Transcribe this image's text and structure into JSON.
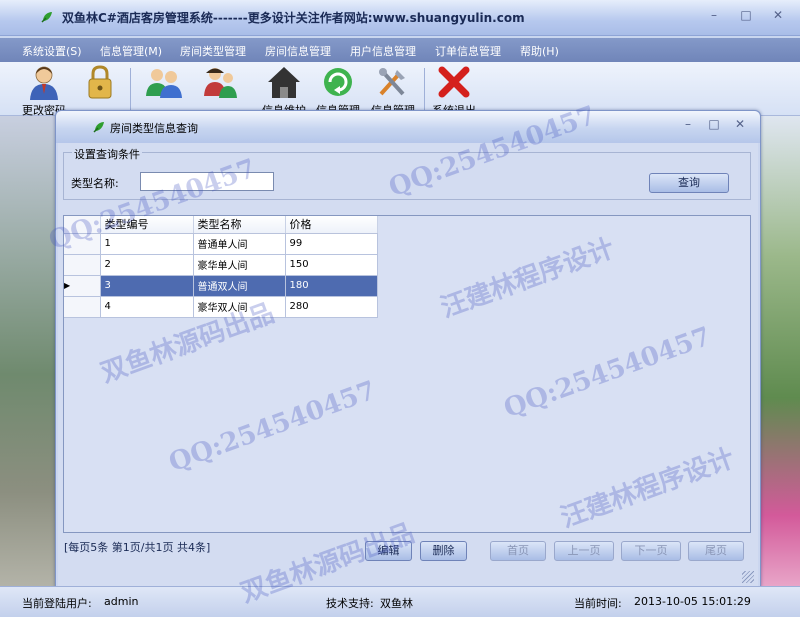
{
  "app": {
    "title": "双鱼林C#酒店客房管理系统-------更多设计关注作者网站:www.shuangyulin.com",
    "window_controls": [
      "–",
      "□",
      "✕"
    ]
  },
  "menu": [
    "系统设置(S)",
    "信息管理(M)",
    "房间类型管理",
    "房间信息管理",
    "用户信息管理",
    "订单信息管理",
    "帮助(H)"
  ],
  "toolbar": {
    "change_password": "更改密码",
    "tool2": "",
    "room_info_maintain": "信息维护",
    "info_manage_1": "信息管理",
    "info_manage_2": "信息管理",
    "exit": "系统退出"
  },
  "child_window": {
    "title": "房间类型信息查询",
    "window_controls": [
      "–",
      "□",
      "✕"
    ]
  },
  "query": {
    "legend": "设置查询条件",
    "type_name_label": "类型名称:",
    "type_name_value": "",
    "search_button": "查询"
  },
  "grid": {
    "columns": [
      "类型编号",
      "类型名称",
      "价格"
    ],
    "rows": [
      {
        "id": "1",
        "name": "普通单人间",
        "price": "99"
      },
      {
        "id": "2",
        "name": "豪华单人间",
        "price": "150"
      },
      {
        "id": "3",
        "name": "普通双人间",
        "price": "180"
      },
      {
        "id": "4",
        "name": "豪华双人间",
        "price": "280"
      }
    ],
    "selected_row": 2,
    "row_pointer": "▶"
  },
  "pager": {
    "summary": "[每页5条  第1页/共1页    共4条]",
    "edit_button": "编辑",
    "delete_button": "删除",
    "first_button": "首页",
    "prev_button": "上一页",
    "next_button": "下一页",
    "last_button": "尾页"
  },
  "statusbar": {
    "user_label": "当前登陆用户:",
    "user_value": "admin",
    "support_label": "技术支持:",
    "support_value": "双鱼林",
    "time_label": "当前时间:",
    "time_value": "2013-10-05 15:01:29"
  },
  "watermarks": {
    "qq": "QQ:254540457",
    "studio": "汪建林程序设计",
    "source": "双鱼林源码出品"
  },
  "colors": {
    "accent": "#4e6bb0",
    "menubar": "#7a8fc2",
    "watermark": "#3c50be"
  }
}
